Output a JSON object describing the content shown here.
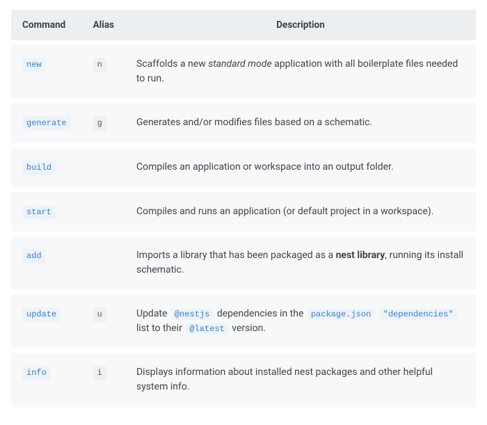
{
  "table": {
    "headers": {
      "command": "Command",
      "alias": "Alias",
      "description": "Description"
    },
    "rows": [
      {
        "command": "new",
        "alias": "n",
        "description_html": "Scaffolds a new <em>standard mode</em> application with all boilerplate files needed to run."
      },
      {
        "command": "generate",
        "alias": "g",
        "description_html": "Generates and/or modifies files based on a schematic."
      },
      {
        "command": "build",
        "alias": "",
        "description_html": "Compiles an application or workspace into an output folder."
      },
      {
        "command": "start",
        "alias": "",
        "description_html": "Compiles and runs an application (or default project in a workspace)."
      },
      {
        "command": "add",
        "alias": "",
        "description_html": "Imports a library that has been packaged as a <strong>nest library</strong>, running its install schematic."
      },
      {
        "command": "update",
        "alias": "u",
        "description_html": "Update <code class=\"inline\">@nestjs</code> dependencies in the <code class=\"inline\">package.json</code> <code class=\"inline\">\"dependencies\"</code> list to their <code class=\"inline\">@latest</code> version."
      },
      {
        "command": "info",
        "alias": "i",
        "description_html": "Displays information about installed nest packages and other helpful system info."
      }
    ]
  }
}
